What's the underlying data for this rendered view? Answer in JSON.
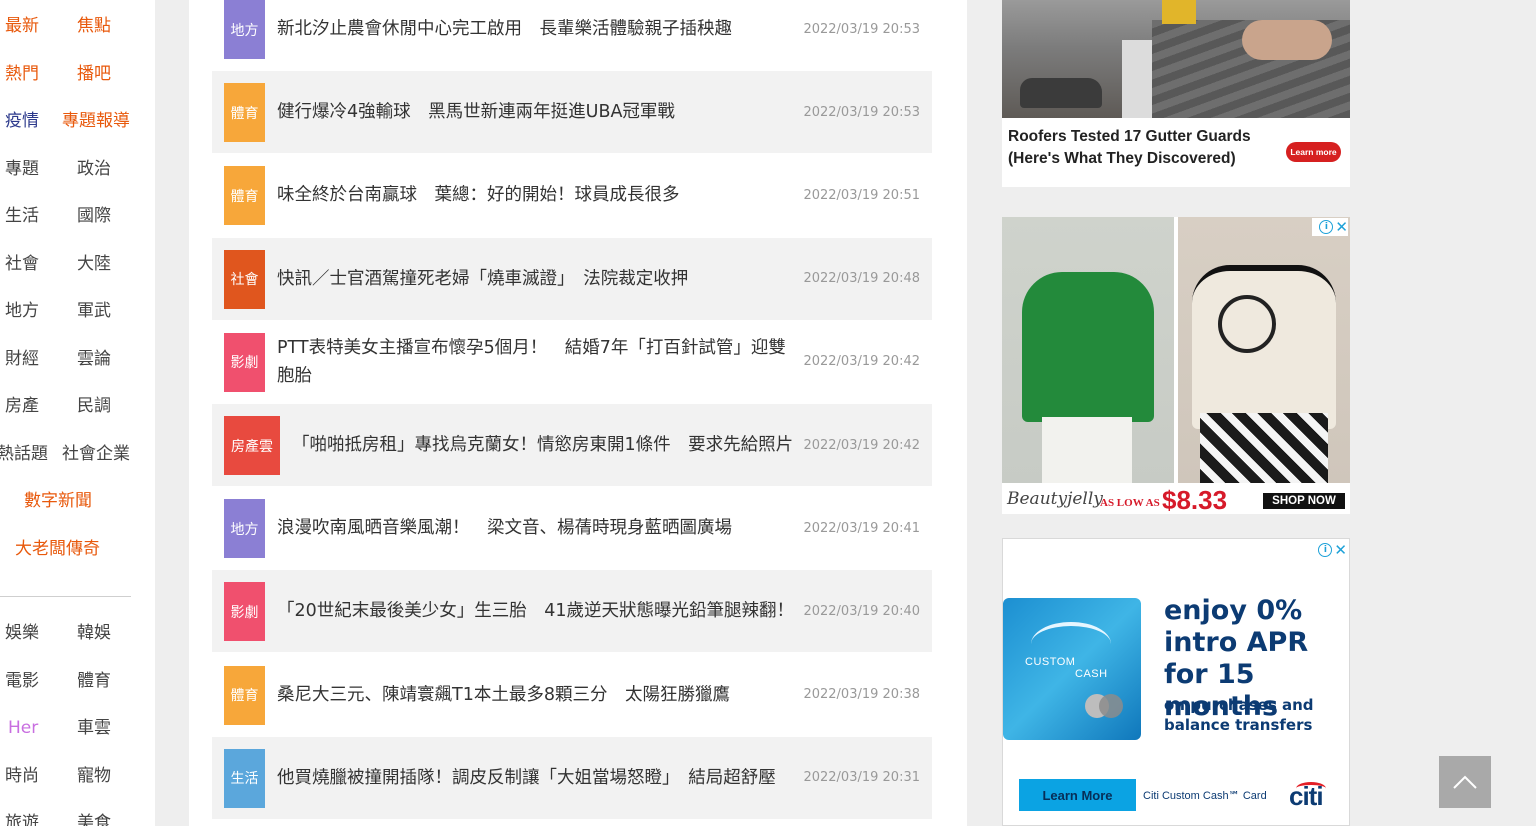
{
  "sidebar": {
    "categories_top": [
      {
        "label": "最新",
        "color": "orange"
      },
      {
        "label": "焦點",
        "color": "orange"
      },
      {
        "label": "熱門",
        "color": "orange"
      },
      {
        "label": "播吧",
        "color": "orange"
      },
      {
        "label": "疫情",
        "color": "blue"
      },
      {
        "label": "專題報導",
        "color": "orange"
      },
      {
        "label": "專題",
        "color": "dark"
      },
      {
        "label": "政治",
        "color": "dark"
      },
      {
        "label": "生活",
        "color": "dark"
      },
      {
        "label": "國際",
        "color": "dark"
      },
      {
        "label": "社會",
        "color": "dark"
      },
      {
        "label": "大陸",
        "color": "dark"
      },
      {
        "label": "地方",
        "color": "dark"
      },
      {
        "label": "軍武",
        "color": "dark"
      },
      {
        "label": "財經",
        "color": "dark"
      },
      {
        "label": "雲論",
        "color": "dark"
      },
      {
        "label": "房產",
        "color": "dark"
      },
      {
        "label": "民調",
        "color": "dark"
      },
      {
        "label": "熱話題",
        "color": "dark"
      },
      {
        "label": "社會企業",
        "color": "dark"
      }
    ],
    "special": [
      "數字新聞",
      "大老闆傳奇"
    ],
    "categories_bottom": [
      {
        "label": "娛樂",
        "color": "dark"
      },
      {
        "label": "韓娛",
        "color": "dark"
      },
      {
        "label": "電影",
        "color": "dark"
      },
      {
        "label": "體育",
        "color": "dark"
      },
      {
        "label": "Her",
        "color": "pink"
      },
      {
        "label": "車雲",
        "color": "dark"
      },
      {
        "label": "時尚",
        "color": "dark"
      },
      {
        "label": "寵物",
        "color": "dark"
      },
      {
        "label": "旅遊",
        "color": "dark"
      },
      {
        "label": "美食",
        "color": "dark"
      }
    ]
  },
  "news": [
    {
      "tag": "地方",
      "tag_color": "#8b7fd4",
      "title": "新北汐止農會休閒中心完工啟用　長輩樂活體驗親子插秧趣",
      "time": "2022/03/19 20:53"
    },
    {
      "tag": "體育",
      "tag_color": "#f7a73a",
      "title": "健行爆冷4強輸球　黑馬世新連兩年挺進UBA冠軍戰",
      "time": "2022/03/19 20:53"
    },
    {
      "tag": "體育",
      "tag_color": "#f7a73a",
      "title": "味全終於台南贏球　葉總：好的開始！球員成長很多",
      "time": "2022/03/19 20:51"
    },
    {
      "tag": "社會",
      "tag_color": "#e0561e",
      "title": "快訊／士官酒駕撞死老婦「燒車滅證」　法院裁定收押",
      "time": "2022/03/19 20:48"
    },
    {
      "tag": "影劇",
      "tag_color": "#f0506e",
      "title": "PTT表特美女主播宣布懷孕5個月！　結婚7年「打百針試管」迎雙胞胎",
      "time": "2022/03/19 20:42"
    },
    {
      "tag": "房產雲",
      "tag_color": "#e84a3f",
      "title": "「啪啪抵房租」專找烏克蘭女！情慾房東開1條件　要求先給照片",
      "time": "2022/03/19 20:42"
    },
    {
      "tag": "地方",
      "tag_color": "#8b7fd4",
      "title": "浪漫吹南風晒音樂風潮！　梁文音、楊蒨時現身藍晒圖廣場",
      "time": "2022/03/19 20:41"
    },
    {
      "tag": "影劇",
      "tag_color": "#f0506e",
      "title": "「20世紀末最後美少女」生三胎　41歲逆天狀態曝光鉛筆腿辣翻！",
      "time": "2022/03/19 20:40"
    },
    {
      "tag": "體育",
      "tag_color": "#f7a73a",
      "title": "桑尼大三元、陳靖寰飆T1本土最多8顆三分　太陽狂勝獵鷹",
      "time": "2022/03/19 20:38"
    },
    {
      "tag": "生活",
      "tag_color": "#5ba7dc",
      "title": "他買燒臘被撞開插隊！調皮反制讓「大姐當場怒瞪」　結局超舒壓",
      "time": "2022/03/19 20:31"
    }
  ],
  "ads": {
    "gutter": {
      "caption": "Roofers Tested 17 Gutter Guards (Here's What They Discovered)",
      "cta": "Learn more"
    },
    "fashion": {
      "brand": "Beautyjelly",
      "as_low_as": "AS LOW AS",
      "price": "$8.33",
      "cta": "SHOP NOW"
    },
    "citi": {
      "card_label_1": "CUSTOM",
      "card_label_2": "CASH",
      "headline": "enjoy 0% intro APR for 15 months",
      "sub": "on purchases and balance transfers",
      "cta": "Learn More",
      "card_name": "Citi Custom Cash℠ Card",
      "logo": "citi"
    }
  }
}
